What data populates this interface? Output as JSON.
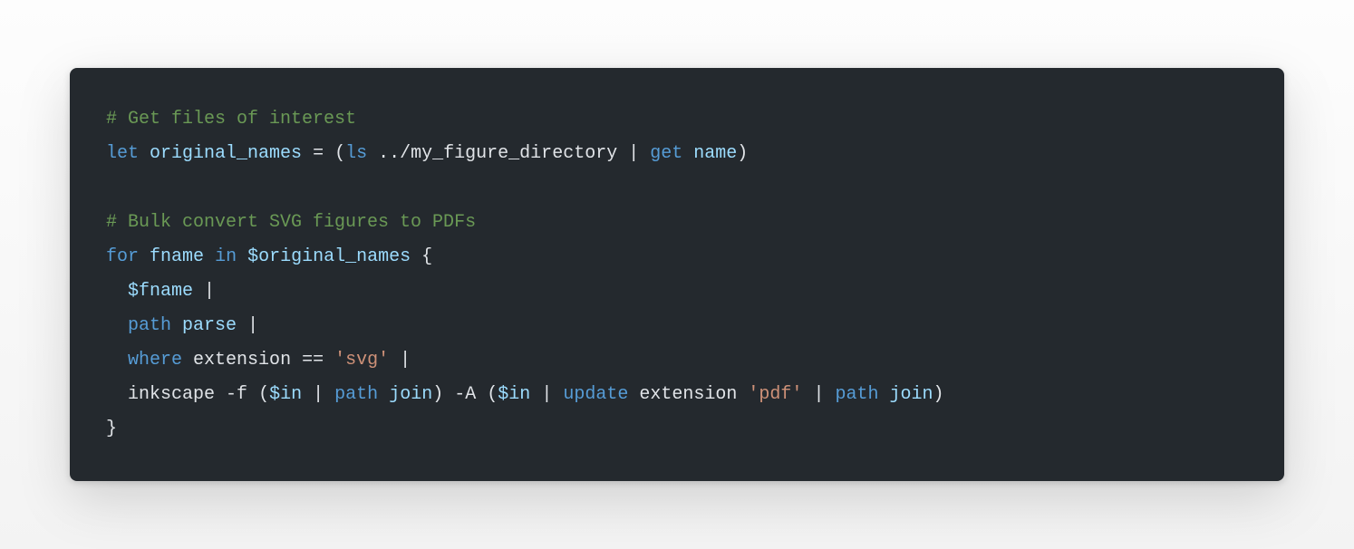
{
  "code": {
    "line1": {
      "comment": "# Get files of interest"
    },
    "line2": {
      "let": "let",
      "var": "original_names",
      "eq": "=",
      "lp": "(",
      "ls": "ls",
      "path": "../my_figure_directory",
      "pipe": "|",
      "get": "get",
      "name": "name",
      "rp": ")"
    },
    "line3": "",
    "line4": {
      "comment": "# Bulk convert SVG figures to PDFs"
    },
    "line5": {
      "for": "for",
      "fname": "fname",
      "in": "in",
      "dollar": "$original_names",
      "lb": "{"
    },
    "line6": {
      "dollar": "$fname",
      "pipe": "|"
    },
    "line7": {
      "path": "path",
      "parse": "parse",
      "pipe": "|"
    },
    "line8": {
      "where": "where",
      "ext_word": "extension",
      "eq": "==",
      "svg": "'svg'",
      "pipe": "|"
    },
    "line9": {
      "inkscape": "inkscape",
      "f": "-f",
      "lp1": "(",
      "in1": "$in",
      "pipe1": "|",
      "path1": "path",
      "join1": "join",
      "rp1": ")",
      "a": "-A",
      "lp2": "(",
      "in2": "$in",
      "pipe2": "|",
      "update": "update",
      "ext_word": "extension",
      "pdf": "'pdf'",
      "pipe3": "|",
      "path2": "path",
      "join2": "join",
      "rp2": ")"
    },
    "line10": {
      "rb": "}"
    }
  }
}
